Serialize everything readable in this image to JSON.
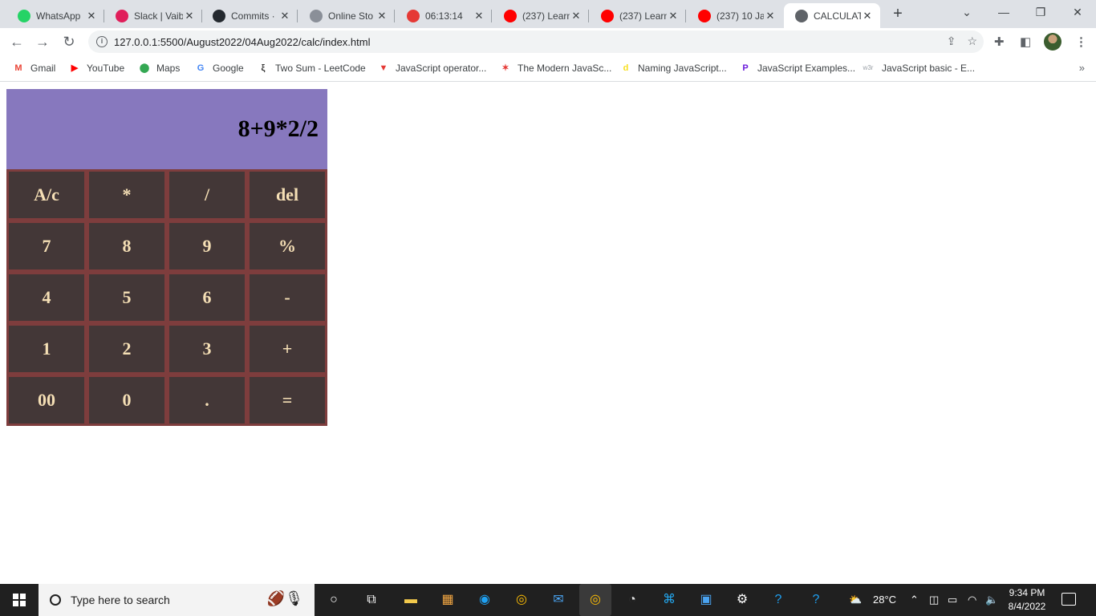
{
  "browser": {
    "tabs": [
      {
        "title": "WhatsApp",
        "icon": "whatsapp-icon",
        "color": "#25d366"
      },
      {
        "title": "Slack | Vaib",
        "icon": "slack-icon",
        "color": "#e01e5a"
      },
      {
        "title": "Commits ·",
        "icon": "github-icon",
        "color": "#24292f"
      },
      {
        "title": "Online Sto",
        "icon": "dots-icon",
        "color": "#8a8f98"
      },
      {
        "title": "06:13:14",
        "icon": "timer-icon",
        "color": "#e53935"
      },
      {
        "title": "(237) Learn",
        "icon": "youtube-icon",
        "color": "#ff0000"
      },
      {
        "title": "(237) Learn",
        "icon": "youtube-icon",
        "color": "#ff0000"
      },
      {
        "title": "(237) 10 Ja",
        "icon": "youtube-icon",
        "color": "#ff0000"
      },
      {
        "title": "CALCULAT",
        "icon": "globe-icon",
        "color": "#5f6368",
        "active": true
      }
    ],
    "url": "127.0.0.1:5500/August2022/04Aug2022/calc/index.html",
    "bookmarks": [
      {
        "label": "Gmail",
        "icon": "gmail-icon",
        "glyph": "M",
        "color": "#ea4335"
      },
      {
        "label": "YouTube",
        "icon": "youtube-icon",
        "glyph": "▶",
        "color": "#ff0000"
      },
      {
        "label": "Maps",
        "icon": "maps-pin-icon",
        "glyph": "⬤",
        "color": "#34a853"
      },
      {
        "label": "Google",
        "icon": "google-icon",
        "glyph": "G",
        "color": "#4285f4"
      },
      {
        "label": "Two Sum - LeetCode",
        "icon": "leetcode-icon",
        "glyph": "ξ",
        "color": "#333333"
      },
      {
        "label": "JavaScript operator...",
        "icon": "tutorials-icon",
        "glyph": "▼",
        "color": "#e53935"
      },
      {
        "label": "The Modern JavaSc...",
        "icon": "javascript-info-icon",
        "glyph": "✶",
        "color": "#e53935"
      },
      {
        "label": "Naming JavaScript...",
        "icon": "dev-icon",
        "glyph": "d",
        "color": "#f7df1e"
      },
      {
        "label": "JavaScript Examples...",
        "icon": "programiz-icon",
        "glyph": "P",
        "color": "#6a1bdb"
      },
      {
        "label": "JavaScript basic - E...",
        "icon": "w3resource-icon",
        "glyph": "w3r",
        "color": "#9aa0a6"
      }
    ]
  },
  "calculator": {
    "display": "8+9*2/2",
    "colors": {
      "display_bg": "#8778be",
      "key_bg": "#433737",
      "key_border": "#7e3d3d",
      "key_text": "#f5dfb5"
    },
    "keys": [
      "A/c",
      "*",
      "/",
      "del",
      "7",
      "8",
      "9",
      "%",
      "4",
      "5",
      "6",
      "-",
      "1",
      "2",
      "3",
      "+",
      "00",
      "0",
      ".",
      "="
    ]
  },
  "taskbar": {
    "search_placeholder": "Type here to search",
    "weather": "28°C",
    "time": "9:34 PM",
    "date": "8/4/2022"
  }
}
